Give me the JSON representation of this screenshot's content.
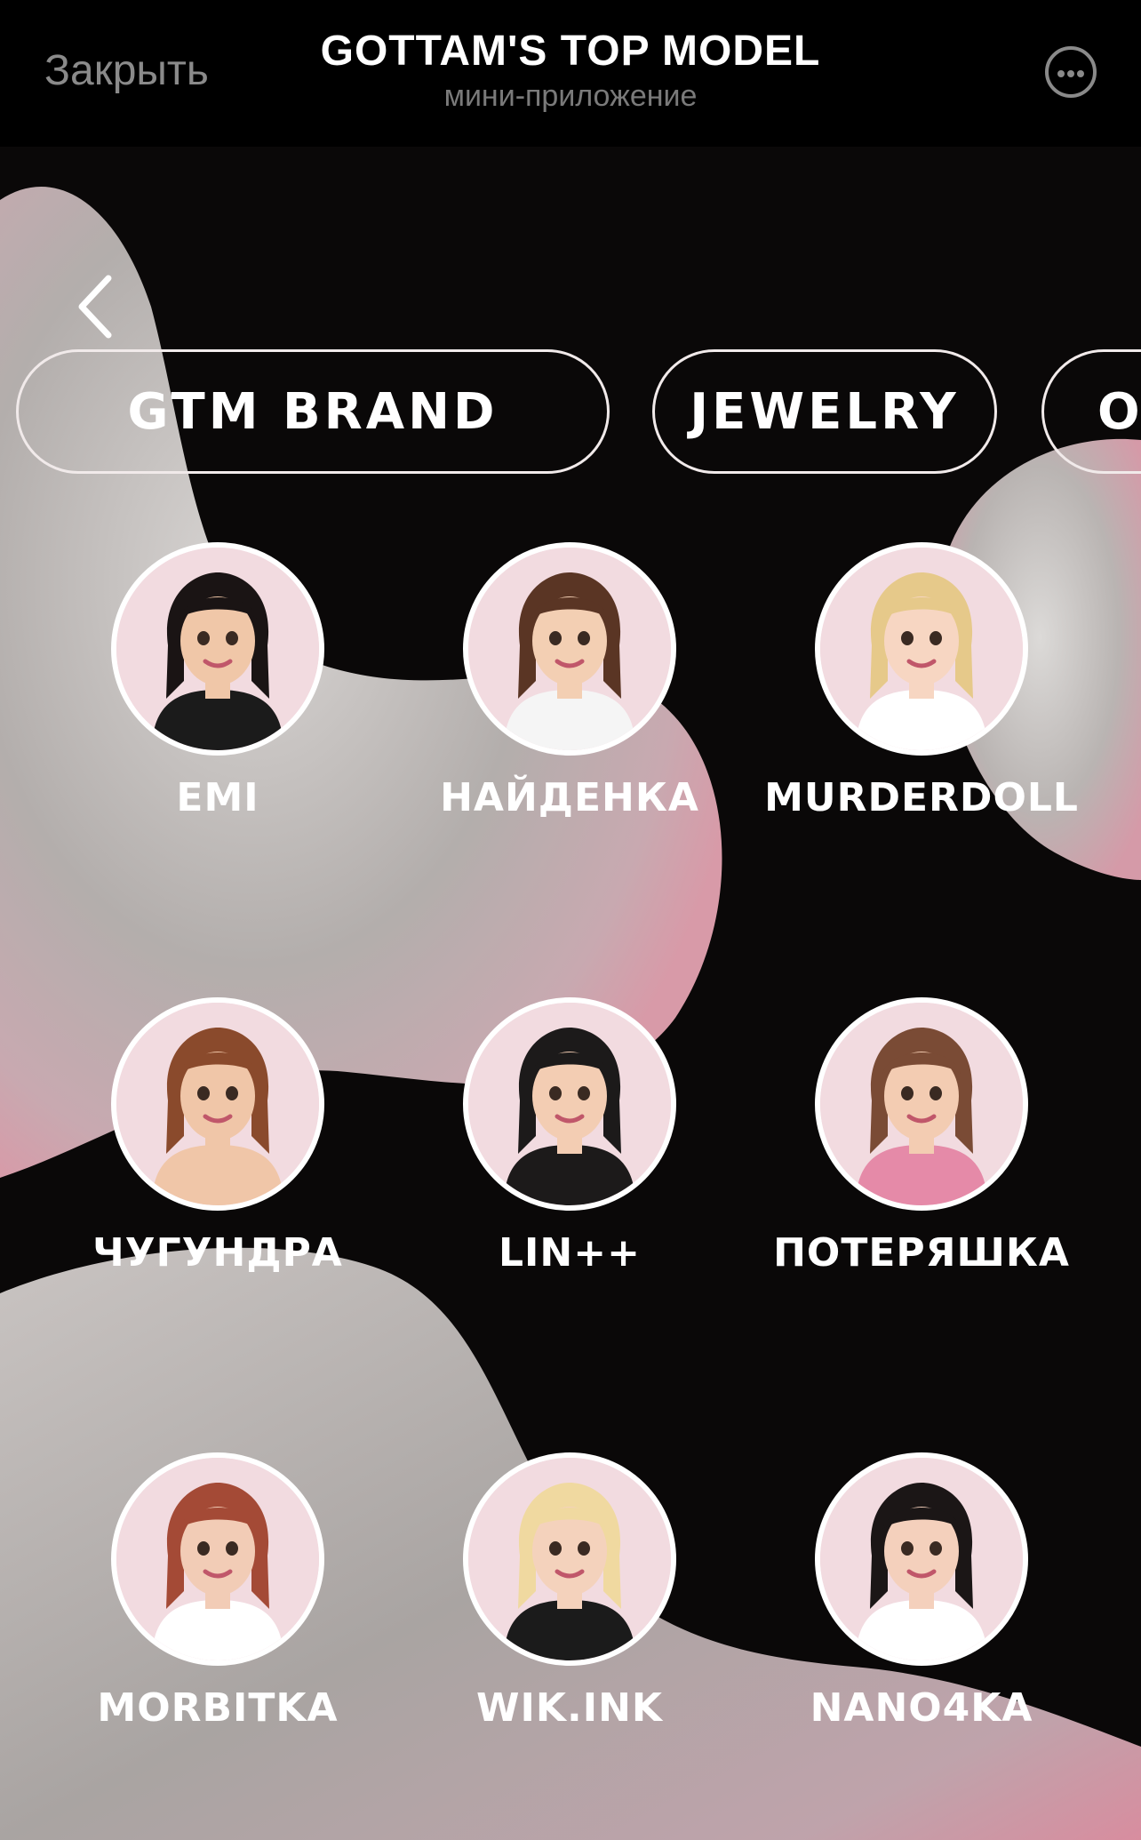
{
  "header": {
    "close_label": "Закрыть",
    "title": "GOTTAM'S TOP MODEL",
    "subtitle": "мини-приложение",
    "more_icon": "more-horizontal-icon"
  },
  "nav": {
    "back_icon": "chevron-left-icon"
  },
  "categories": [
    {
      "label": "GTM BRAND"
    },
    {
      "label": "JEWELRY"
    },
    {
      "label": "O"
    }
  ],
  "models": [
    {
      "name": "EMI",
      "hair": "#1a1414",
      "skin": "#f0c7a8",
      "top": "#1b1b1b"
    },
    {
      "name": "НАЙДЕНКА",
      "hair": "#5a3524",
      "skin": "#f3cfb3",
      "top": "#f5f5f5"
    },
    {
      "name": "MURDERDOLL",
      "hair": "#e6c98a",
      "skin": "#f7d6c2",
      "top": "#ffffff"
    },
    {
      "name": "ЧУГУНДРА",
      "hair": "#8a4a2c",
      "skin": "#f0c6a8",
      "top": "#f0c6a8"
    },
    {
      "name": "LIN++",
      "hair": "#1c1a1a",
      "skin": "#f3cdb3",
      "top": "#1c1a1a"
    },
    {
      "name": "ПОТЕРЯШКА",
      "hair": "#7a4b35",
      "skin": "#f3ccb2",
      "top": "#e58aa8"
    },
    {
      "name": "MORBITKA",
      "hair": "#a44a36",
      "skin": "#f2ccb6",
      "top": "#ffffff"
    },
    {
      "name": "WIK.INK",
      "hair": "#f0d9a0",
      "skin": "#f4d2bc",
      "top": "#1b1b1b"
    },
    {
      "name": "NANO4KA",
      "hair": "#1b1616",
      "skin": "#f4d0bc",
      "top": "#ffffff"
    }
  ]
}
